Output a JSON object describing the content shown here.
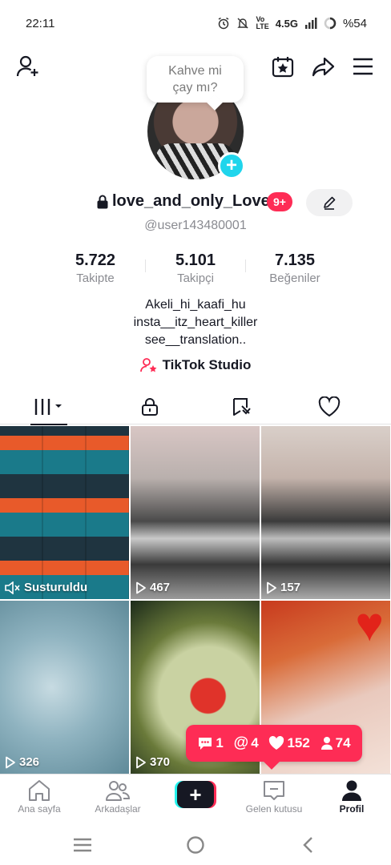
{
  "status_bar": {
    "time": "22:11",
    "network": "4.5G",
    "battery": "%54"
  },
  "profile": {
    "note": [
      "Kahve mi",
      "çay mı?"
    ],
    "username": "love_and_only_Love",
    "notification_badge": "9+",
    "handle": "@user143480001",
    "stats": [
      {
        "value": "5.722",
        "label": "Takipte"
      },
      {
        "value": "5.101",
        "label": "Takipçi"
      },
      {
        "value": "7.135",
        "label": "Beğeniler"
      }
    ],
    "bio": [
      "Akeli_hi_kaafi_hu",
      "insta__itz_heart_killer",
      "see__translation.."
    ],
    "studio_link": "TikTok Studio"
  },
  "tabs": [
    {
      "icon": "grid-icon",
      "active": true
    },
    {
      "icon": "lock-icon",
      "active": false
    },
    {
      "icon": "repost-icon",
      "active": false
    },
    {
      "icon": "heart-icon",
      "active": false
    }
  ],
  "videos": [
    {
      "label": "Susturuldu",
      "icon": "muted-icon"
    },
    {
      "label": "467",
      "icon": "play-icon"
    },
    {
      "label": "157",
      "icon": "play-icon"
    },
    {
      "label": "326",
      "icon": "play-icon"
    },
    {
      "label": "370",
      "icon": "play-icon"
    },
    {
      "label": "",
      "icon": "play-icon"
    }
  ],
  "activity": {
    "comments": "1",
    "mentions": "4",
    "likes": "152",
    "followers": "74"
  },
  "bottom_nav": [
    {
      "label": "Ana sayfa",
      "icon": "home-icon"
    },
    {
      "label": "Arkadaşlar",
      "icon": "friends-icon"
    },
    {
      "label": "",
      "icon": "plus-icon"
    },
    {
      "label": "Gelen kutusu",
      "icon": "inbox-icon"
    },
    {
      "label": "Profil",
      "icon": "profile-icon"
    }
  ],
  "colors": {
    "accent": "#fe2c55",
    "cyan": "#25f4ee",
    "avatar_add": "#20d5ec",
    "text": "#161823",
    "secondary": "#8a8b91"
  }
}
